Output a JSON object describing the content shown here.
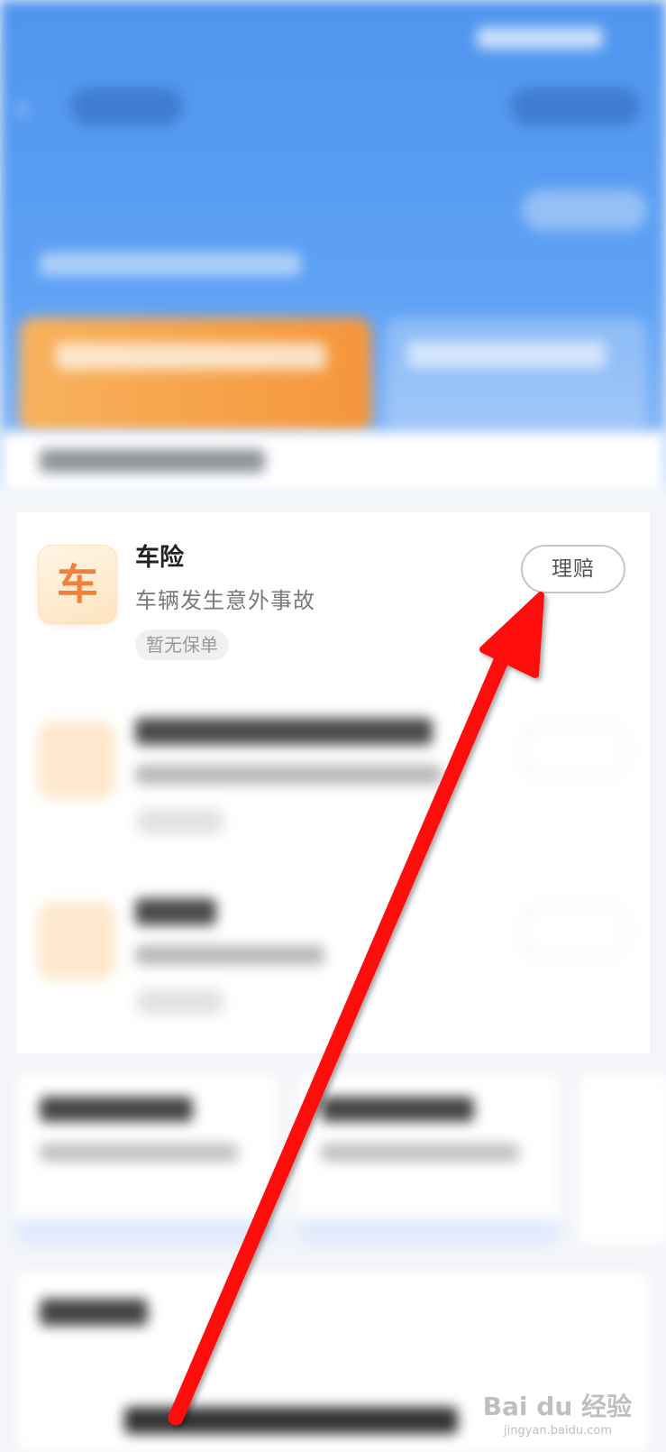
{
  "insurance_item": {
    "icon_char": "车",
    "title": "车险",
    "description": "车辆发生意外事故",
    "tag": "暂无保单",
    "claim_label": "理赔"
  },
  "watermark": {
    "brand": "Bai du 经验",
    "site": "jingyan.baidu.com"
  },
  "annotation": {
    "arrow_color": "#ff1010"
  }
}
